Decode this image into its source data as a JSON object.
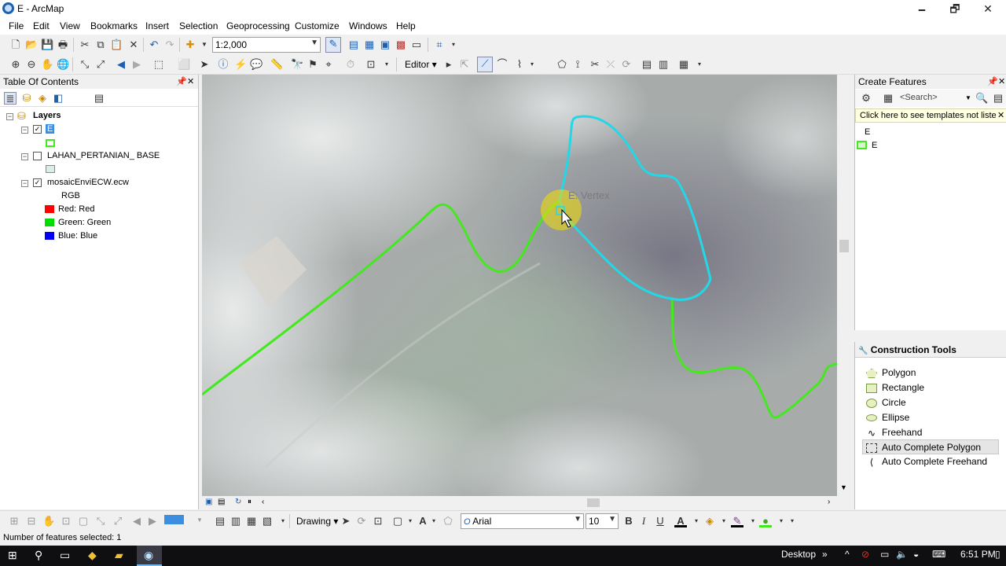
{
  "window": {
    "title": "E - ArcMap",
    "controls": [
      "🗕",
      "🗗",
      "✕"
    ]
  },
  "menu": [
    "File",
    "Edit",
    "View",
    "Bookmarks",
    "Insert",
    "Selection",
    "Geoprocessing",
    "Customize",
    "Windows",
    "Help"
  ],
  "toolbar": {
    "scale": "1:2,000",
    "editor_label": "Editor ▾"
  },
  "toc": {
    "title": "Table Of Contents",
    "root": "Layers",
    "layers": [
      {
        "name": "E",
        "checked": true
      },
      {
        "name": "LAHAN_PERTANIAN_ BASE",
        "checked": false
      },
      {
        "name": "mosaicEnviECW.ecw",
        "checked": true
      }
    ],
    "rgb_label": "RGB",
    "bands": [
      {
        "label": "Red:   Red",
        "color": "#ff0000"
      },
      {
        "label": "Green: Green",
        "color": "#00dd00"
      },
      {
        "label": "Blue:  Blue",
        "color": "#0000ff"
      }
    ]
  },
  "map": {
    "tooltip": "E: Vertex",
    "line_colors": {
      "green": "#44e81f",
      "cyan": "#22d8e8"
    }
  },
  "create_features": {
    "title": "Create Features",
    "search_placeholder": "<Search>",
    "hint": "Click here to see templates not liste",
    "group": "E",
    "template": "E"
  },
  "construction_tools": {
    "title": "Construction Tools",
    "items": [
      "Polygon",
      "Rectangle",
      "Circle",
      "Ellipse",
      "Freehand",
      "Auto Complete Polygon",
      "Auto Complete Freehand"
    ],
    "selected": "Auto Complete Polygon"
  },
  "drawing": {
    "label": "Drawing ▾",
    "font": "Arial",
    "size": "10",
    "bold": "B",
    "italic": "I",
    "underline": "U",
    "text_tool": "A"
  },
  "status": {
    "text": "Number of features selected: 1"
  },
  "taskbar": {
    "desktop": "Desktop",
    "time": "6:51 PM"
  }
}
